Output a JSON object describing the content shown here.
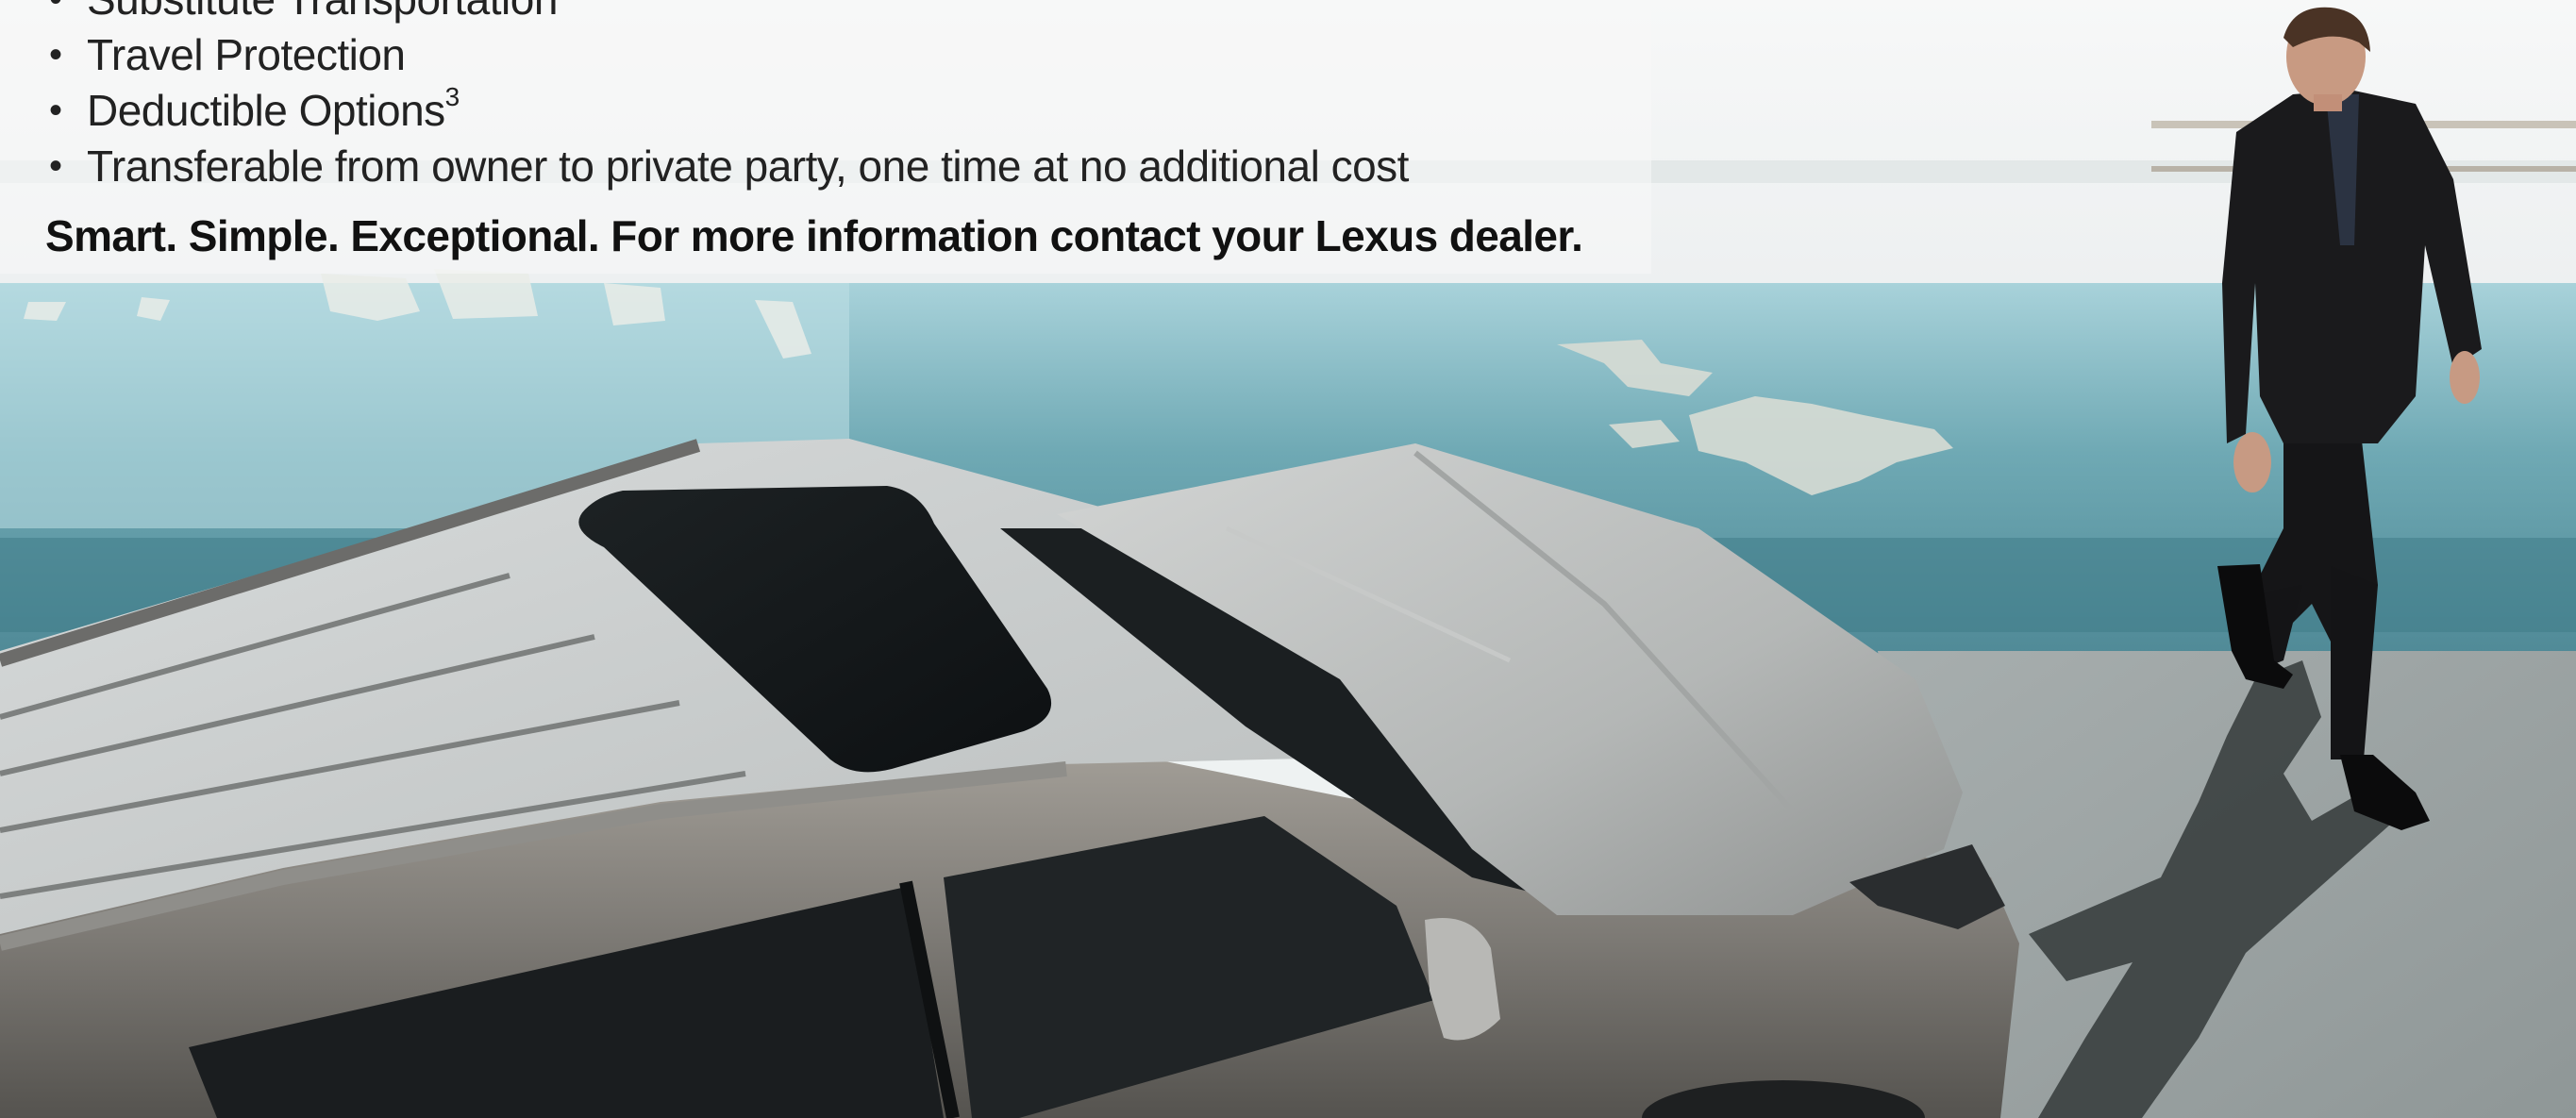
{
  "features": {
    "items": [
      {
        "label": "Substitute Transportation",
        "sup": ""
      },
      {
        "label": "Travel Protection",
        "sup": ""
      },
      {
        "label": "Deductible Options",
        "sup": "3"
      },
      {
        "label": "Transferable from owner to private party, one time at no additional cost",
        "sup": ""
      }
    ],
    "bullet": "•"
  },
  "tagline": "Smart. Simple. Exceptional. For more information contact your Lexus dealer.",
  "colors": {
    "wall": "#f4f6f6",
    "water": "#6aa2ae",
    "ground": "#9aa2a2",
    "car_body": "#8e8a84",
    "roof": "#c9cccc",
    "suit": "#1a1a1c"
  }
}
